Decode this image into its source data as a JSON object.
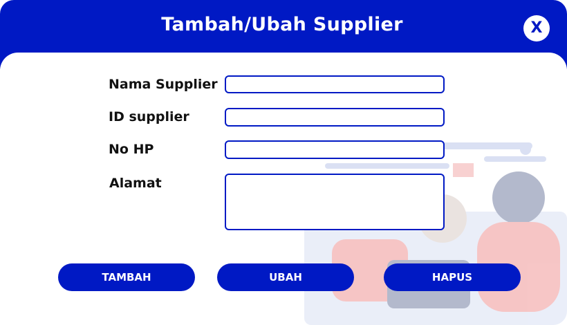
{
  "dialog": {
    "title": "Tambah/Ubah Supplier",
    "close_label": "X"
  },
  "form": {
    "nama_supplier_label": "Nama Supplier",
    "nama_supplier_value": "",
    "id_supplier_label": "ID supplier",
    "id_supplier_value": "",
    "no_hp_label": "No HP",
    "no_hp_value": "",
    "alamat_label": "Alamat",
    "alamat_value": ""
  },
  "actions": {
    "tambah_label": "TAMBAH",
    "ubah_label": "UBAH",
    "hapus_label": "HAPUS"
  },
  "colors": {
    "primary": "#0019c4",
    "background": "#ffffff",
    "text": "#111111"
  }
}
